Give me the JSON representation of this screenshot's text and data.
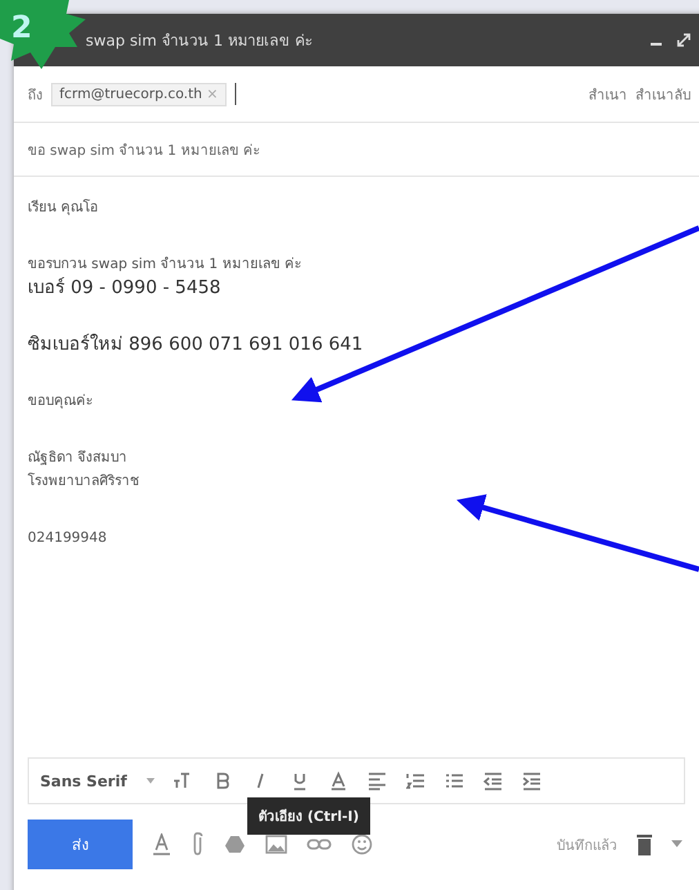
{
  "step_badge": "2",
  "window": {
    "title": "swap sim จำนวน 1 หมายเลข ค่ะ"
  },
  "to": {
    "label": "ถึง",
    "recipients": [
      "fcrm@truecorp.co.th"
    ],
    "remove": "×",
    "cc": "สำเนา",
    "bcc": "สำเนาลับ"
  },
  "subject": "ขอ swap sim จำนวน 1 หมายเลข ค่ะ",
  "body": [
    {
      "lines": [
        "เรียน คุณโอ"
      ],
      "large": false
    },
    {
      "lines": [
        "ขอรบกวน swap sim จำนวน 1 หมายเลข ค่ะ"
      ],
      "large": false
    },
    {
      "lines": [
        "เบอร์ 09 - 0990 - 5458"
      ],
      "large": true
    },
    {
      "lines": [
        "ซิมเบอร์ใหม่ 896 600 071 691 016 641"
      ],
      "large": true
    },
    {
      "lines": [
        "ขอบคุณค่ะ"
      ],
      "large": false
    },
    {
      "lines": [
        "ณัฐธิดา จึงสมบา",
        "โรงพยาบาลศิริราช"
      ],
      "large": false
    },
    {
      "lines": [
        "024199948"
      ],
      "large": false
    }
  ],
  "toolbar": {
    "font": "Sans Serif",
    "tooltip": "ตัวเอียง (Ctrl-I)"
  },
  "footer": {
    "send": "ส่ง",
    "saved": "บันทึกแล้ว"
  }
}
